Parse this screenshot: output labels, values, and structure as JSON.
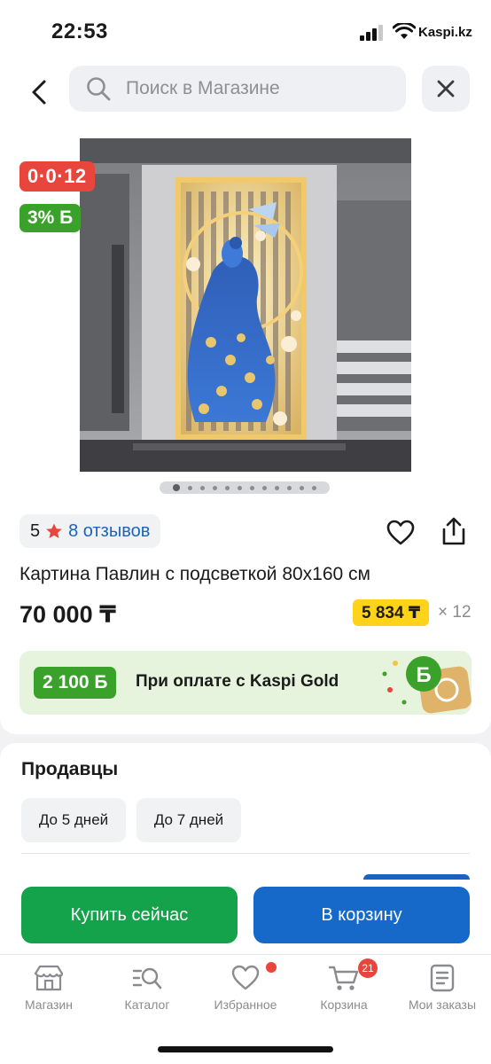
{
  "status_bar": {
    "time": "22:53",
    "carrier": "Kaspi.kz"
  },
  "search": {
    "placeholder": "Поиск в Магазине"
  },
  "badges": {
    "installment": "0·0·12",
    "bonus": "3% Б"
  },
  "gallery": {
    "image_count": 12,
    "active_index": 0
  },
  "rating": {
    "value": "5",
    "reviews": "8 отзывов"
  },
  "product": {
    "title": "Картина Павлин с подсветкой 80х160 см",
    "price": "70 000 ₸",
    "installment_price": "5 834 ₸",
    "installment_months": "× 12"
  },
  "kaspi_gold": {
    "bonus": "2 100 Б",
    "text": "При оплате с Kaspi Gold"
  },
  "sellers": {
    "title": "Продавцы",
    "filters": [
      "До 5 дней",
      "До 7 дней"
    ]
  },
  "actions": {
    "buy_now": "Купить сейчас",
    "add_to_cart": "В корзину"
  },
  "tabbar": {
    "items": [
      {
        "label": "Магазин",
        "icon": "store-icon"
      },
      {
        "label": "Каталог",
        "icon": "catalog-icon"
      },
      {
        "label": "Избранное",
        "icon": "heart-icon",
        "dot": true
      },
      {
        "label": "Корзина",
        "icon": "cart-icon",
        "badge": "21"
      },
      {
        "label": "Мои заказы",
        "icon": "orders-icon"
      }
    ]
  },
  "colors": {
    "accent_red": "#e8453c",
    "bonus_green": "#3aa12b",
    "buy_green": "#14a24a",
    "cart_blue": "#1669c8",
    "installment_yellow": "#ffd31a",
    "link_blue": "#1a63bf"
  }
}
